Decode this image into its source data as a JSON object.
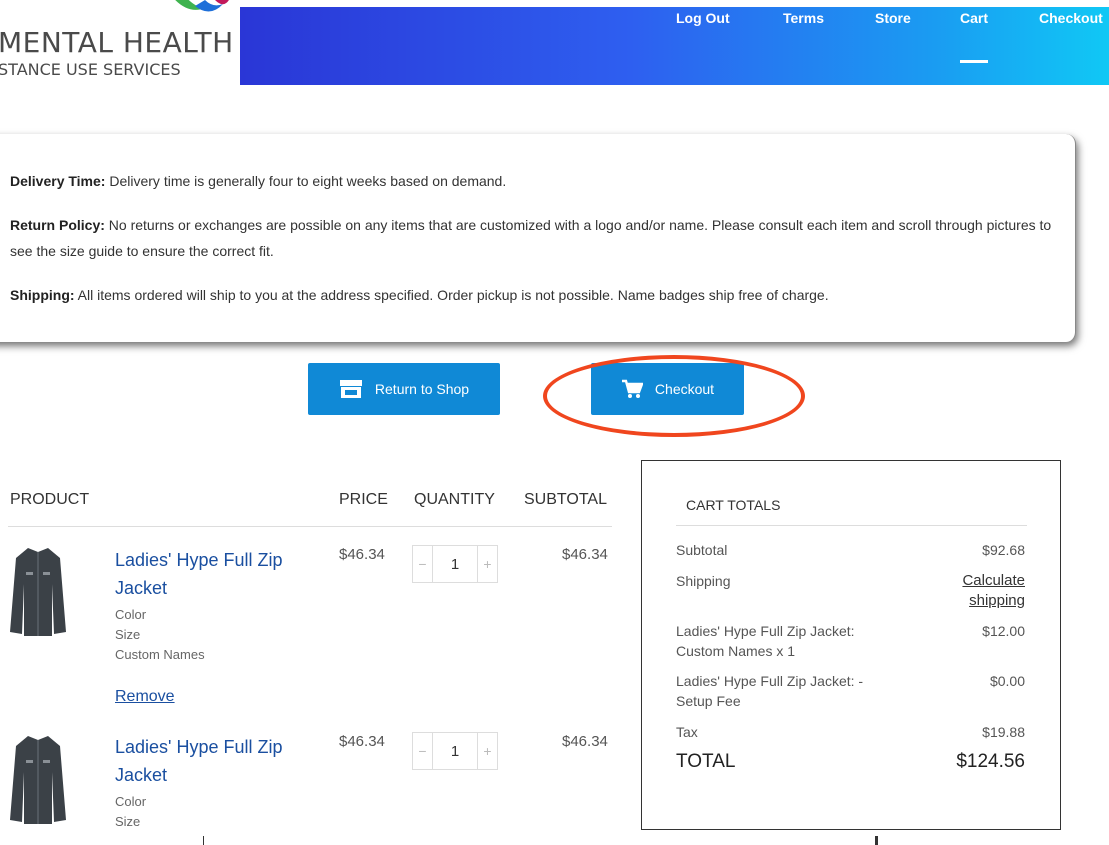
{
  "colors": {
    "accent": "#1089d6",
    "highlight": "#f0461e",
    "link": "#1a4fa0"
  },
  "logo": {
    "line1": "MENTAL HEALTH",
    "line2": "STANCE USE SERVICES"
  },
  "nav": {
    "items": [
      "Log Out",
      "Terms",
      "Store",
      "Cart",
      "Checkout"
    ],
    "active": "Cart"
  },
  "info": {
    "delivery_label": "Delivery Time:",
    "delivery_text": " Delivery time is generally four to eight weeks based on demand.",
    "return_label": "Return Policy:",
    "return_text": " No returns or exchanges are possible on any items that are customized with a logo and/or name. Please consult each item and scroll through pictures to see the size guide to ensure the correct fit.",
    "shipping_label": "Shipping:",
    "shipping_text": " All items ordered will ship to you at the address specified. Order pickup is not possible. Name badges ship free of charge."
  },
  "buttons": {
    "return_to_shop": "Return to Shop",
    "return_icon": "store-icon",
    "checkout": "Checkout",
    "checkout_icon": "cart-icon"
  },
  "table": {
    "headers": {
      "product": "PRODUCT",
      "price": "PRICE",
      "quantity": "QUANTITY",
      "subtotal": "SUBTOTAL"
    },
    "rows": [
      {
        "name_line1": "Ladies' Hype Full Zip",
        "name_line2": "Jacket",
        "meta": [
          "Color",
          "Size",
          "Custom Names"
        ],
        "price": "$46.34",
        "quantity": "1",
        "subtotal": "$46.34",
        "remove": "Remove"
      },
      {
        "name_line1": "Ladies' Hype Full Zip",
        "name_line2": "Jacket",
        "meta": [
          "Color",
          "Size"
        ],
        "price": "$46.34",
        "quantity": "1",
        "subtotal": "$46.34"
      }
    ],
    "minus": "−",
    "plus": "+"
  },
  "totals": {
    "title": "CART TOTALS",
    "subtotal_label": "Subtotal",
    "subtotal_value": "$92.68",
    "shipping_label": "Shipping",
    "shipping_link_line1": "Calculate",
    "shipping_link_line2": "shipping",
    "fee1_label_line1": "Ladies' Hype Full Zip Jacket:",
    "fee1_label_line2": "Custom Names x 1",
    "fee1_value": "$12.00",
    "fee2_label_line1": "Ladies' Hype Full Zip Jacket: -",
    "fee2_label_line2": "Setup Fee",
    "fee2_value": "$0.00",
    "tax_label": "Tax",
    "tax_value": "$19.88",
    "total_label": "TOTAL",
    "total_value": "$124.56"
  }
}
